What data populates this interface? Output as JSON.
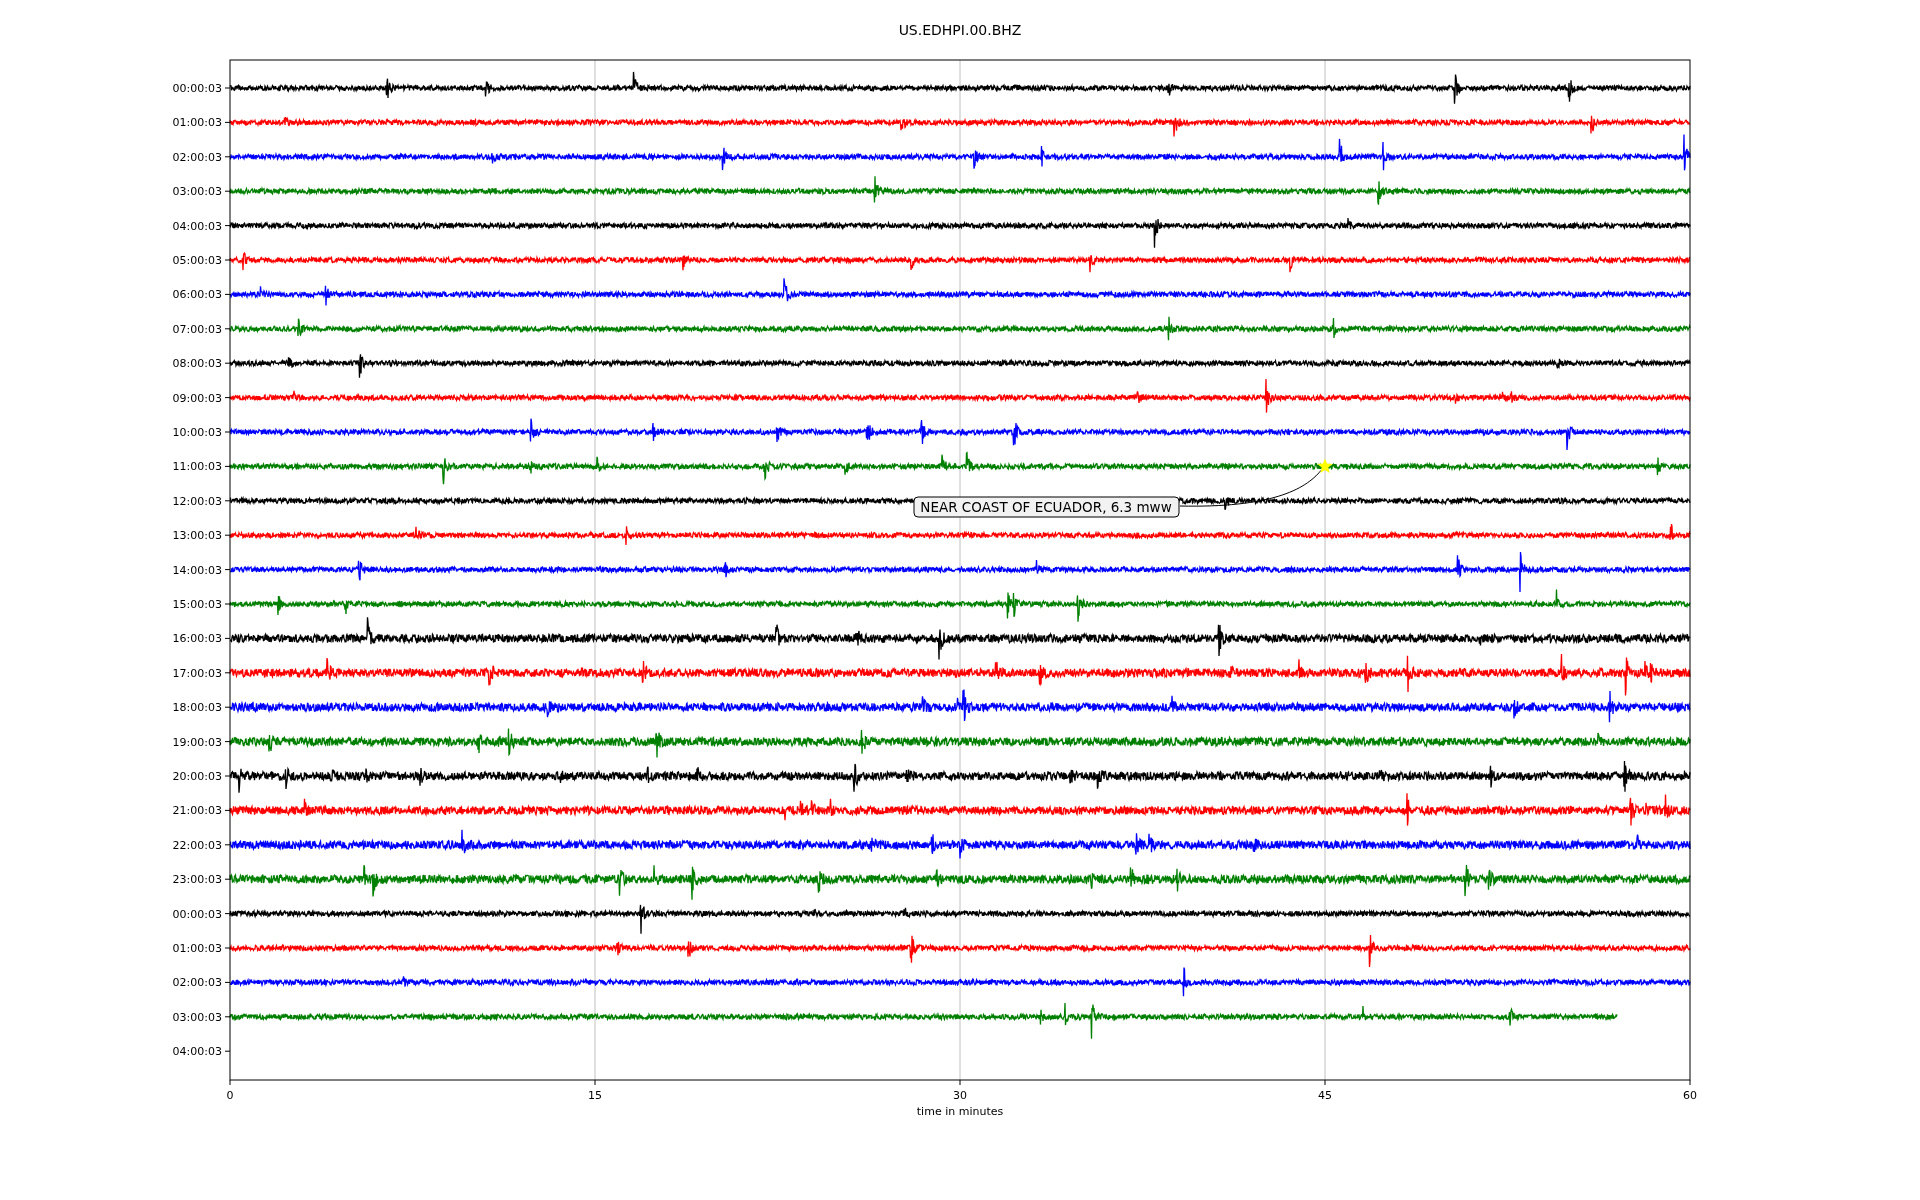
{
  "title": "US.EDHPI.00.BHZ",
  "x_axis": {
    "label": "time in minutes",
    "ticks": [
      "0",
      "15",
      "30",
      "45",
      "60"
    ]
  },
  "rows": [
    {
      "label": "00:00:03",
      "color": "#000000",
      "level": 1
    },
    {
      "label": "01:00:03",
      "color": "#ff0000",
      "level": 1
    },
    {
      "label": "02:00:03",
      "color": "#0000ff",
      "level": 1
    },
    {
      "label": "03:00:03",
      "color": "#008000",
      "level": 1
    },
    {
      "label": "04:00:03",
      "color": "#000000",
      "level": 1
    },
    {
      "label": "05:00:03",
      "color": "#ff0000",
      "level": 1
    },
    {
      "label": "06:00:03",
      "color": "#0000ff",
      "level": 1
    },
    {
      "label": "07:00:03",
      "color": "#008000",
      "level": 1
    },
    {
      "label": "08:00:03",
      "color": "#000000",
      "level": 1
    },
    {
      "label": "09:00:03",
      "color": "#ff0000",
      "level": 1
    },
    {
      "label": "10:00:03",
      "color": "#0000ff",
      "level": 1
    },
    {
      "label": "11:00:03",
      "color": "#008000",
      "level": 1
    },
    {
      "label": "12:00:03",
      "color": "#000000",
      "level": 1
    },
    {
      "label": "13:00:03",
      "color": "#ff0000",
      "level": 1
    },
    {
      "label": "14:00:03",
      "color": "#0000ff",
      "level": 1
    },
    {
      "label": "15:00:03",
      "color": "#008000",
      "level": 1
    },
    {
      "label": "16:00:03",
      "color": "#000000",
      "level": 1
    },
    {
      "label": "17:00:03",
      "color": "#ff0000",
      "level": 1
    },
    {
      "label": "18:00:03",
      "color": "#0000ff",
      "level": 1
    },
    {
      "label": "19:00:03",
      "color": "#008000",
      "level": 1
    },
    {
      "label": "20:00:03",
      "color": "#000000",
      "level": 1
    },
    {
      "label": "21:00:03",
      "color": "#ff0000",
      "level": 1
    },
    {
      "label": "22:00:03",
      "color": "#0000ff",
      "level": 1
    },
    {
      "label": "23:00:03",
      "color": "#008000",
      "level": 1
    },
    {
      "label": "00:00:03",
      "color": "#000000",
      "level": 1
    },
    {
      "label": "01:00:03",
      "color": "#ff0000",
      "level": 1
    },
    {
      "label": "02:00:03",
      "color": "#0000ff",
      "level": 1
    },
    {
      "label": "03:00:03",
      "color": "#008000",
      "level": 0.95
    },
    {
      "label": "04:00:03"
    }
  ],
  "annotation": {
    "text": "NEAR COAST OF ECUADOR, 6.3 mww"
  }
}
